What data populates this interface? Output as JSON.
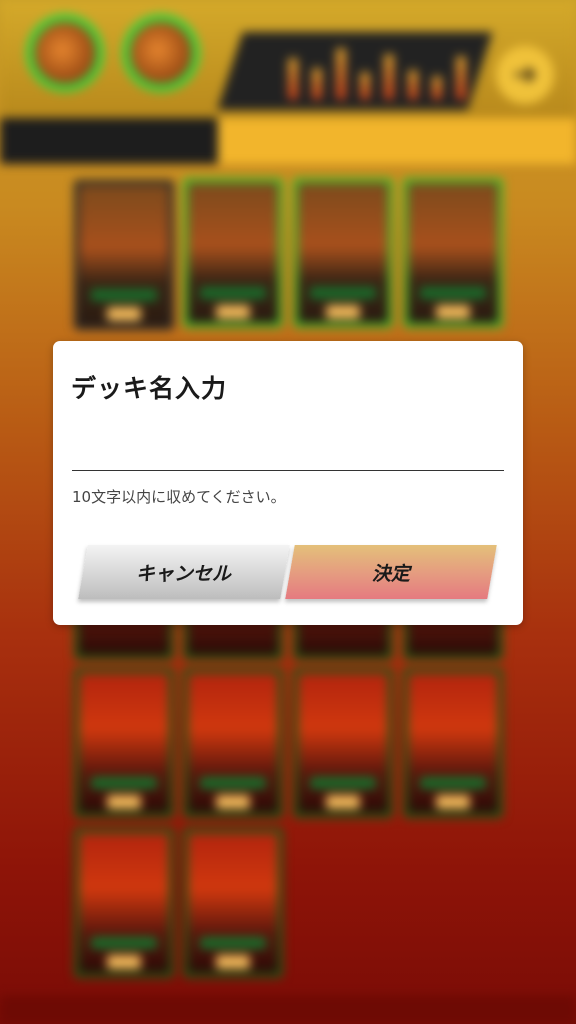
{
  "dialog": {
    "title": "デッキ名入力",
    "input_value": "",
    "hint": "10文字以内に収めてください。",
    "cancel_label": "キャンセル",
    "confirm_label": "決定"
  },
  "background": {
    "next_icon": "arrow-right-icon",
    "colors": {
      "top": "#c9a028",
      "bottom": "#7a0c06",
      "highlight_border": "#3fbb2e"
    }
  }
}
